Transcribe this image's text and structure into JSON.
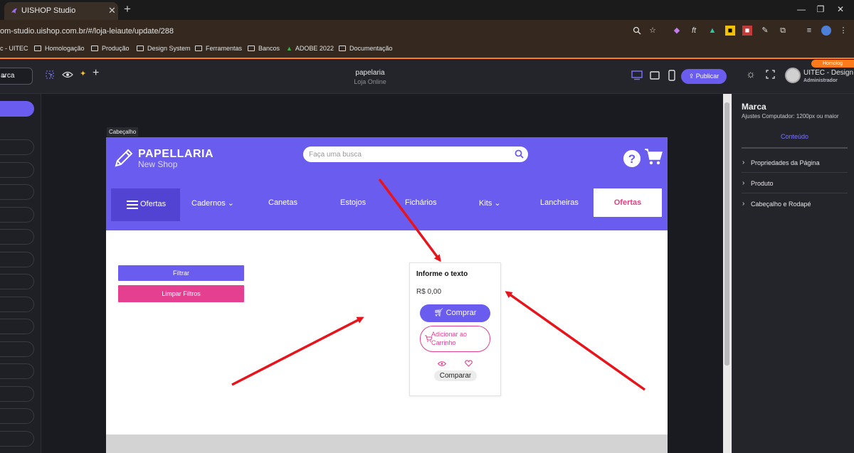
{
  "browser": {
    "tab_title": "UISHOP Studio",
    "url": "om-studio.uishop.com.br/#/loja-leiaute/update/288",
    "bookmarks": [
      "c - UITEC",
      "Homologação",
      "Produção",
      "Design System",
      "Ferramentas",
      "Bancos",
      "ADOBE 2022",
      "Documentação"
    ]
  },
  "app": {
    "selector_value": "arca",
    "page_name": "papelaria",
    "page_subtitle": "Loja Online",
    "publish_label": "Publicar",
    "env_badge": "Homolog",
    "user_name": "UITEC - Design",
    "user_role": "Administrador"
  },
  "canvas": {
    "section_label": "Cabeçalho"
  },
  "site": {
    "logo_name": "PAPELLARIA",
    "logo_sub": "New Shop",
    "search_placeholder": "Faça uma busca",
    "menu_label": "Ofertas",
    "nav": {
      "cadernos": "Cadernos",
      "canetas": "Canetas",
      "estojos": "Estojos",
      "fichario": "Fichários",
      "kits": "Kits",
      "lancheiras": "Lancheiras",
      "ofertas": "Ofertas"
    },
    "filter_label": "Filtrar",
    "clear_label": "Limpar Filtros",
    "card": {
      "title": "Informe o texto",
      "price": "R$ 0,00",
      "buy_label": "Comprar",
      "add_label": "Adicionar ao Carrinho",
      "compare_label": "Comparar"
    },
    "colors": {
      "primary": "#6b5cf0",
      "accent": "#e53f8f"
    }
  },
  "right_panel": {
    "title": "Marca",
    "subtitle": "Ajustes Computador: 1200px ou maior",
    "tab": "Conteúdo",
    "sections": [
      "Propriedades da Página",
      "Produto",
      "Cabeçalho e Rodapé"
    ]
  }
}
